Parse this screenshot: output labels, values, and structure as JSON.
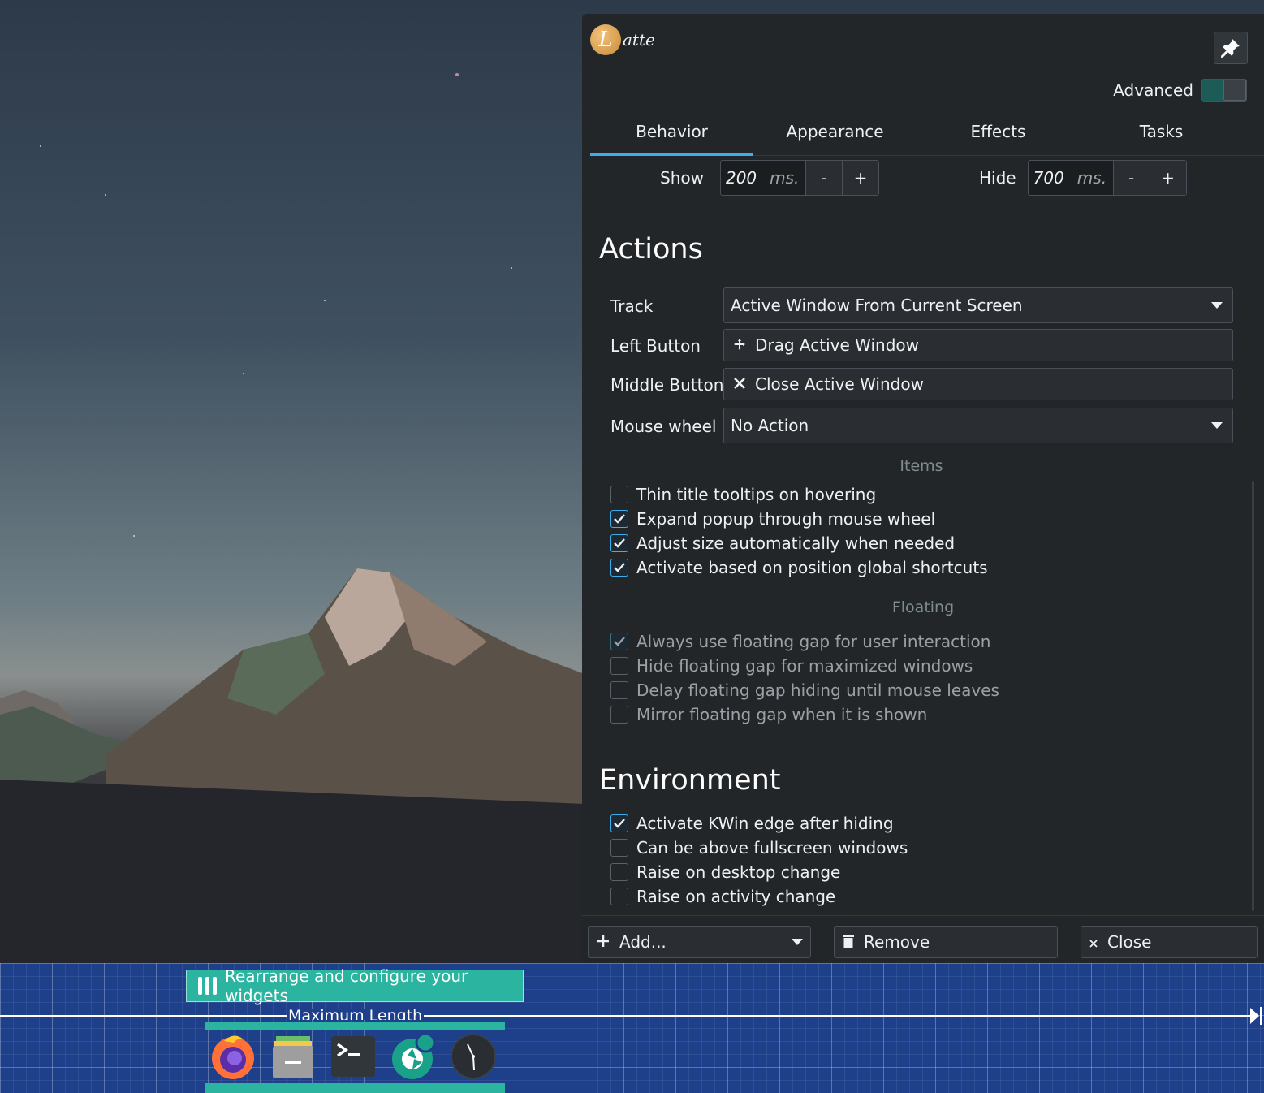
{
  "app": {
    "logo_text": "atte"
  },
  "header": {
    "advanced_label": "Advanced",
    "advanced_on": true
  },
  "tabs": [
    {
      "label": "Behavior",
      "active": true
    },
    {
      "label": "Appearance",
      "active": false
    },
    {
      "label": "Effects",
      "active": false
    },
    {
      "label": "Tasks",
      "active": false
    }
  ],
  "timing": {
    "show": {
      "label": "Show",
      "value": "200",
      "unit": "ms.",
      "minus": "-",
      "plus": "+"
    },
    "hide": {
      "label": "Hide",
      "value": "700",
      "unit": "ms.",
      "minus": "-",
      "plus": "+"
    }
  },
  "actions": {
    "title": "Actions",
    "track": {
      "label": "Track",
      "value": "Active Window From Current Screen"
    },
    "left_button": {
      "label": "Left Button",
      "value": "Drag Active Window",
      "icon": "drag-move-icon"
    },
    "middle_button": {
      "label": "Middle Button",
      "value": "Close Active Window",
      "icon": "close-icon"
    },
    "mouse_wheel": {
      "label": "Mouse wheel",
      "value": "No Action"
    }
  },
  "items": {
    "title": "Items",
    "options": [
      {
        "label": "Thin title tooltips on hovering",
        "checked": false
      },
      {
        "label": "Expand popup through mouse wheel",
        "checked": true
      },
      {
        "label": "Adjust size automatically when needed",
        "checked": true
      },
      {
        "label": "Activate based on position global shortcuts",
        "checked": true
      }
    ]
  },
  "floating": {
    "title": "Floating",
    "options": [
      {
        "label": "Always use floating gap for user interaction",
        "checked": true
      },
      {
        "label": "Hide floating gap for maximized windows",
        "checked": false
      },
      {
        "label": "Delay floating gap hiding until mouse leaves",
        "checked": false
      },
      {
        "label": "Mirror floating gap when it is shown",
        "checked": false
      }
    ]
  },
  "environment": {
    "title": "Environment",
    "options": [
      {
        "label": "Activate KWin edge after hiding",
        "checked": true
      },
      {
        "label": "Can be above fullscreen windows",
        "checked": false
      },
      {
        "label": "Raise on desktop change",
        "checked": false
      },
      {
        "label": "Raise on activity change",
        "checked": false
      }
    ]
  },
  "footer": {
    "add": "Add...",
    "remove": "Remove",
    "close": "Close"
  },
  "dock": {
    "rearrange_label": "Rearrange and configure your widgets",
    "max_length_label": "Maximum Length",
    "apps": [
      "firefox-icon",
      "file-manager-icon",
      "terminal-icon",
      "screenshot-icon",
      "clock-icon"
    ]
  },
  "colors": {
    "accent": "#3daee9",
    "teal": "#2bb5a0",
    "window_bg": "#232629",
    "dock_bg": "#1e3f8a"
  }
}
